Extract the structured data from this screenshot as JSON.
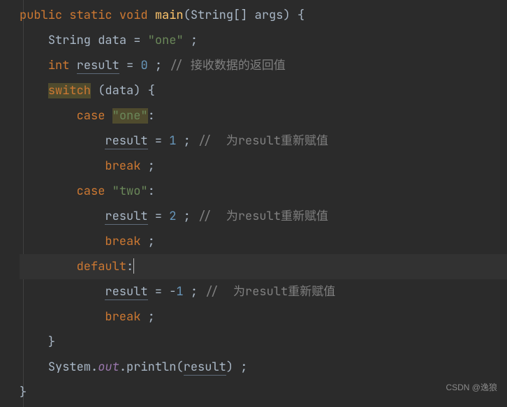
{
  "code": {
    "kw_public": "public",
    "kw_static": "static",
    "kw_void": "void",
    "fn_main": "main",
    "type_string_arr": "String[] args",
    "type_string": "String",
    "var_data": "data",
    "str_one": "\"one\"",
    "kw_int": "int",
    "var_result": "result",
    "num_0": "0",
    "cmt_recv": "// 接收数据的返回值",
    "kw_switch": "switch",
    "kw_case": "case",
    "num_1": "1",
    "cmt_reassign": "//  为result重新赋值",
    "kw_break": "break",
    "str_two": "\"two\"",
    "num_2": "2",
    "kw_default": "default",
    "num_m1": "1",
    "minus": "-",
    "sys": "System.",
    "out": "out",
    "println": ".println(",
    "semi": " ;",
    "colon": ":",
    "eq": " = ",
    "op_brace": " {",
    "cl_brace": "}",
    "op_paren": " (",
    "cl_paren": ") ",
    "cl_paren2": ")"
  },
  "watermark": "CSDN @逸狼"
}
